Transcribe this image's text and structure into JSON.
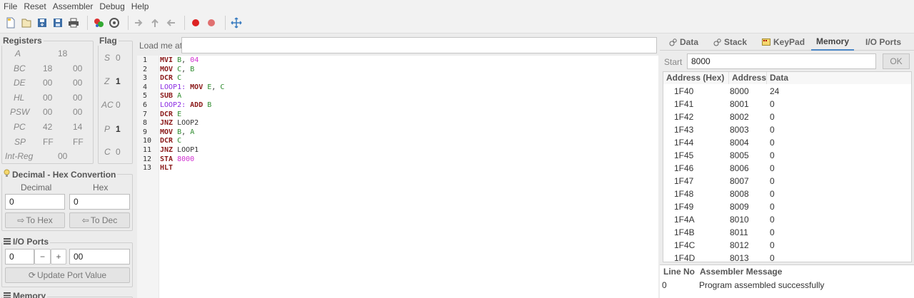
{
  "menu": [
    "File",
    "Reset",
    "Assembler",
    "Debug",
    "Help"
  ],
  "toolbar_icons": [
    "new-file-icon",
    "open-file-icon",
    "save-icon",
    "save-as-icon",
    "print-icon",
    "assemble-icon",
    "run-icon",
    "step-over-icon",
    "step-up-icon",
    "step-back-icon",
    "breakpoint-icon",
    "breakpoint-disabled-icon",
    "move-icon"
  ],
  "registers": {
    "title": "Registers",
    "rows": [
      {
        "name": "A",
        "v1": "18",
        "v2": ""
      },
      {
        "name": "BC",
        "v1": "18",
        "v2": "00"
      },
      {
        "name": "DE",
        "v1": "00",
        "v2": "00"
      },
      {
        "name": "HL",
        "v1": "00",
        "v2": "00"
      },
      {
        "name": "PSW",
        "v1": "00",
        "v2": "00"
      },
      {
        "name": "PC",
        "v1": "42",
        "v2": "14"
      },
      {
        "name": "SP",
        "v1": "FF",
        "v2": "FF"
      }
    ],
    "intreg_label": "Int-Reg",
    "intreg_value": "00"
  },
  "flags": {
    "title": "Flag",
    "rows": [
      {
        "name": "S",
        "value": "0"
      },
      {
        "name": "Z",
        "value": "1"
      },
      {
        "name": "AC",
        "value": "0"
      },
      {
        "name": "P",
        "value": "1"
      },
      {
        "name": "C",
        "value": "0"
      }
    ]
  },
  "conversion": {
    "title": "Decimal - Hex Convertion",
    "decimal_label": "Decimal",
    "hex_label": "Hex",
    "decimal_value": "0",
    "hex_value": "0",
    "to_hex": "To Hex",
    "to_dec": "To Dec"
  },
  "io_ports": {
    "title": "I/O Ports",
    "port_value": "0",
    "minus": "−",
    "plus": "+",
    "data_value": "00",
    "update_label": "Update Port Value"
  },
  "memory_group_title": "Memory",
  "editor": {
    "load_label": "Load me at",
    "load_value": "",
    "line_numbers": [
      "1",
      "2",
      "3",
      "4",
      "5",
      "6",
      "7",
      "8",
      "9",
      "10",
      "11",
      "12",
      "13"
    ]
  },
  "right_tabs": [
    "Data",
    "Stack",
    "KeyPad",
    "Memory",
    "I/O Ports"
  ],
  "memory": {
    "start_label": "Start",
    "start_value": "8000",
    "ok_label": "OK",
    "headers": [
      "Address (Hex)",
      "Address",
      "Data"
    ],
    "rows": [
      [
        "1F40",
        "8000",
        "24"
      ],
      [
        "1F41",
        "8001",
        "0"
      ],
      [
        "1F42",
        "8002",
        "0"
      ],
      [
        "1F43",
        "8003",
        "0"
      ],
      [
        "1F44",
        "8004",
        "0"
      ],
      [
        "1F45",
        "8005",
        "0"
      ],
      [
        "1F46",
        "8006",
        "0"
      ],
      [
        "1F47",
        "8007",
        "0"
      ],
      [
        "1F48",
        "8008",
        "0"
      ],
      [
        "1F49",
        "8009",
        "0"
      ],
      [
        "1F4A",
        "8010",
        "0"
      ],
      [
        "1F4B",
        "8011",
        "0"
      ],
      [
        "1F4C",
        "8012",
        "0"
      ],
      [
        "1F4D",
        "8013",
        "0"
      ]
    ]
  },
  "messages": {
    "headers": [
      "Line No",
      "Assembler Message"
    ],
    "rows": [
      [
        "0",
        "Program assembled successfully"
      ]
    ]
  },
  "code_tokens": [
    [
      "MVI",
      "B",
      ",",
      "04"
    ],
    [
      "MOV",
      "C",
      ",",
      "B"
    ],
    [
      "DCR",
      "C"
    ],
    [
      "LOOP1:",
      "MOV",
      "E",
      ",",
      "C"
    ],
    [
      "SUB",
      "A"
    ],
    [
      "LOOP2:",
      "ADD",
      "B"
    ],
    [
      "DCR",
      "E"
    ],
    [
      "JNZ",
      "LOOP2"
    ],
    [
      "MOV",
      "B",
      ",",
      "A"
    ],
    [
      "DCR",
      "C"
    ],
    [
      "JNZ",
      "LOOP1"
    ],
    [
      "STA",
      "8000"
    ],
    [
      "HLT"
    ]
  ]
}
